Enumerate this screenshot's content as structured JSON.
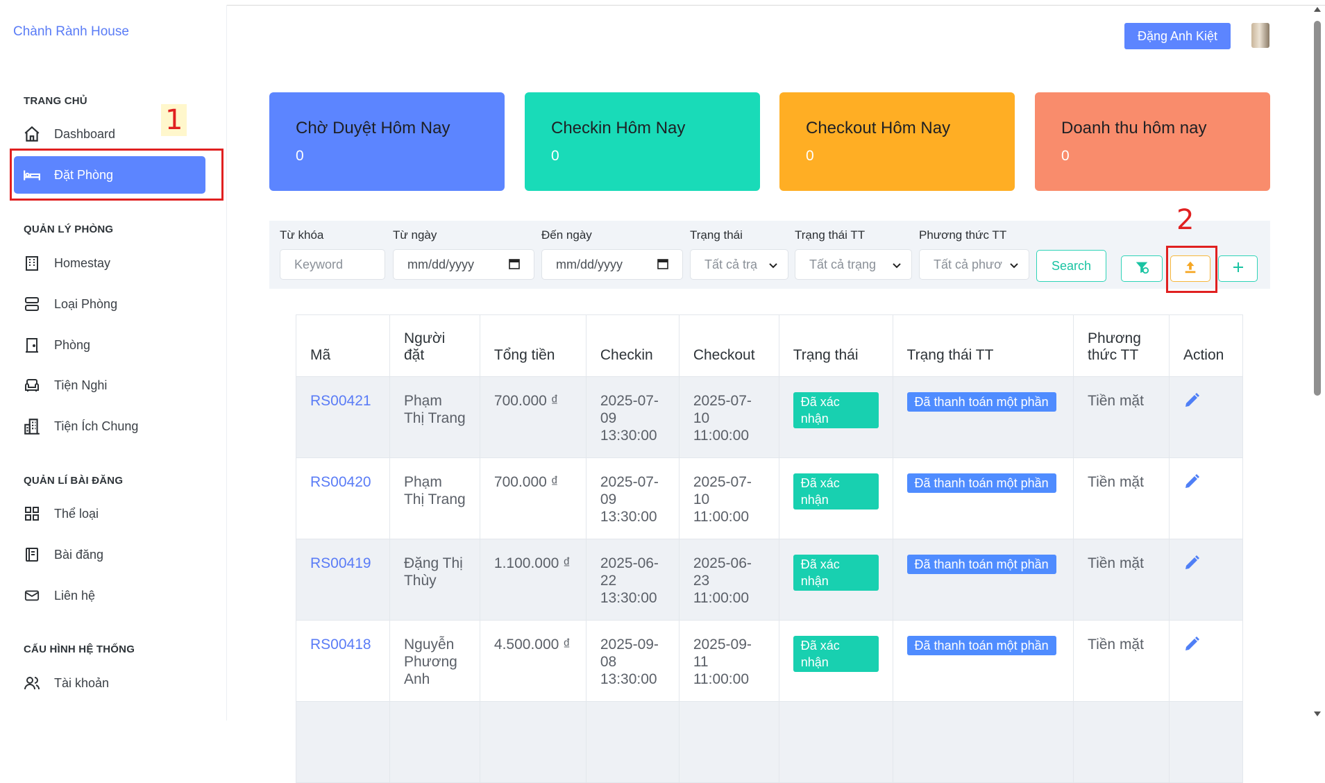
{
  "brand": "Chành Rành House",
  "sidebar": {
    "sections": [
      {
        "title": "TRANG CHỦ",
        "items": [
          {
            "label": "Dashboard",
            "icon": "home-icon"
          },
          {
            "label": "Đặt Phòng",
            "icon": "bed-icon",
            "active": true
          }
        ]
      },
      {
        "title": "QUẢN LÝ PHÒNG",
        "items": [
          {
            "label": "Homestay",
            "icon": "building-icon"
          },
          {
            "label": "Loại Phòng",
            "icon": "layers-icon"
          },
          {
            "label": "Phòng",
            "icon": "door-icon"
          },
          {
            "label": "Tiện Nghi",
            "icon": "sofa-icon"
          },
          {
            "label": "Tiện Ích Chung",
            "icon": "city-icon"
          }
        ]
      },
      {
        "title": "QUẢN LÍ BÀI ĐĂNG",
        "items": [
          {
            "label": "Thể loại",
            "icon": "grid-icon"
          },
          {
            "label": "Bài đăng",
            "icon": "book-icon"
          },
          {
            "label": "Liên hệ",
            "icon": "mail-icon"
          }
        ]
      },
      {
        "title": "CẤU HÌNH HỆ THỐNG",
        "items": [
          {
            "label": "Tài khoản",
            "icon": "users-icon"
          }
        ]
      }
    ]
  },
  "annotations": {
    "one": "1",
    "two": "2"
  },
  "header": {
    "user": "Đặng Anh Kiệt"
  },
  "stats": [
    {
      "title": "Chờ Duyệt Hôm Nay",
      "value": "0",
      "color": "#5c85ff"
    },
    {
      "title": "Checkin Hôm Nay",
      "value": "0",
      "color": "#19dbb8"
    },
    {
      "title": "Checkout Hôm Nay",
      "value": "0",
      "color": "#ffae24"
    },
    {
      "title": "Doanh thu hôm nay",
      "value": "0",
      "color": "#f98c6c"
    }
  ],
  "filters": {
    "keyword_label": "Từ khóa",
    "keyword_placeholder": "Keyword",
    "from_label": "Từ ngày",
    "from_placeholder": "mm/dd/yyyy",
    "to_label": "Đến ngày",
    "to_placeholder": "mm/dd/yyyy",
    "status_label": "Trạng thái",
    "status_value": "Tất cả trạ",
    "pay_status_label": "Trạng thái TT",
    "pay_status_value": "Tất cả trạng",
    "pay_method_label": "Phương thức TT",
    "pay_method_value": "Tất cả phươ",
    "search_label": "Search"
  },
  "table": {
    "headers": [
      "Mã",
      "Người đặt",
      "Tổng tiền",
      "Checkin",
      "Checkout",
      "Trạng thái",
      "Trạng thái TT",
      "Phương thức TT",
      "Action"
    ],
    "rows": [
      {
        "code": "RS00421",
        "name": "Phạm Thị Trang",
        "total": "700.000 ₫",
        "checkin": "2025-07-09 13:30:00",
        "checkout": "2025-07-10 11:00:00",
        "status": "Đã xác nhận",
        "pay_status": "Đã thanh toán một phần",
        "method": "Tiền mặt"
      },
      {
        "code": "RS00420",
        "name": "Phạm Thị Trang",
        "total": "700.000 ₫",
        "checkin": "2025-07-09 13:30:00",
        "checkout": "2025-07-10 11:00:00",
        "status": "Đã xác nhận",
        "pay_status": "Đã thanh toán một phần",
        "method": "Tiền mặt"
      },
      {
        "code": "RS00419",
        "name": "Đặng Thị Thùy",
        "total": "1.100.000 ₫",
        "checkin": "2025-06-22 13:30:00",
        "checkout": "2025-06-23 11:00:00",
        "status": "Đã xác nhận",
        "pay_status": "Đã thanh toán một phần",
        "method": "Tiền mặt"
      },
      {
        "code": "RS00418",
        "name": "Nguyễn Phương Anh",
        "total": "4.500.000 ₫",
        "checkin": "2025-09-08 13:30:00",
        "checkout": "2025-09-11 11:00:00",
        "status": "Đã xác nhận",
        "pay_status": "Đã thanh toán một phần",
        "method": "Tiền mặt"
      }
    ]
  }
}
